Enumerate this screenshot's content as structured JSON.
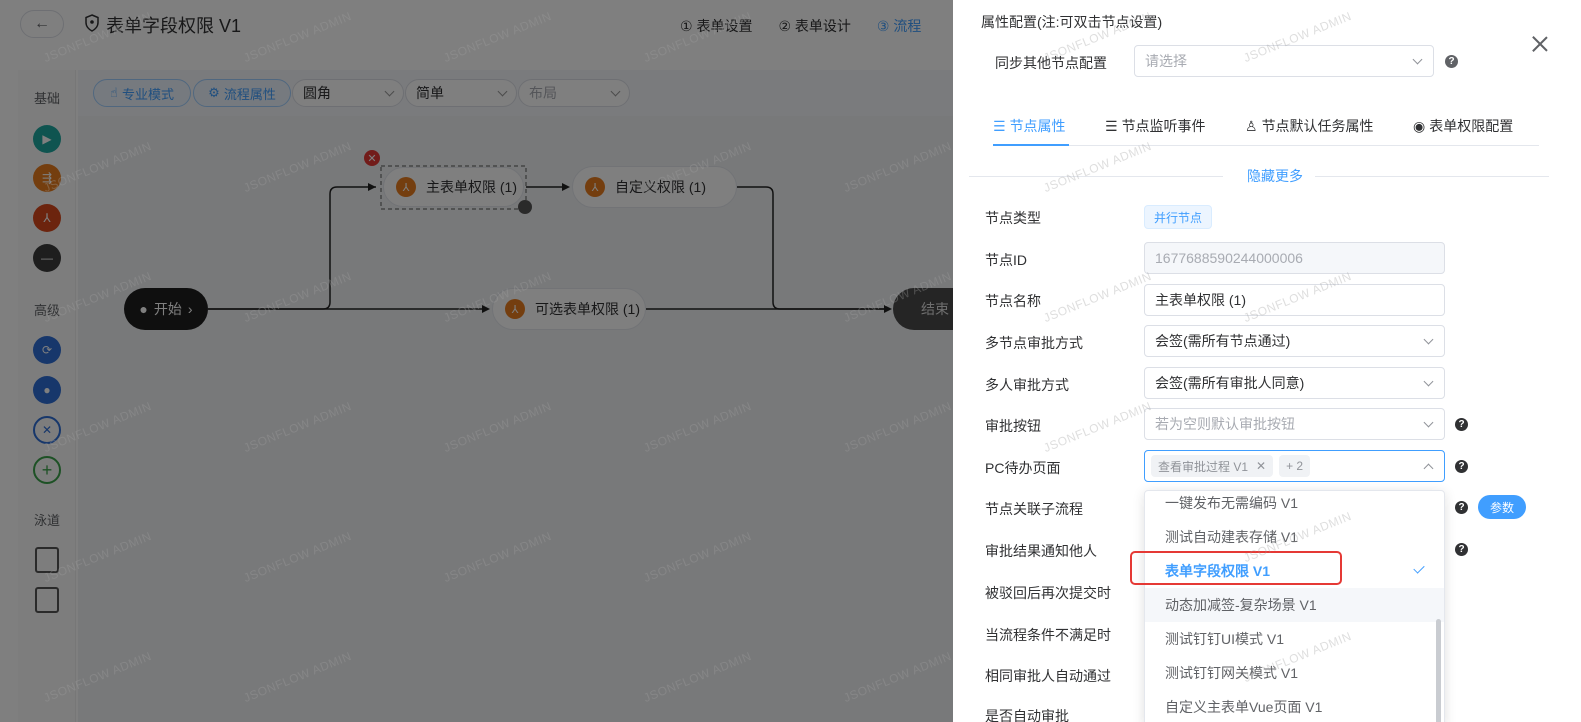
{
  "header": {
    "back_icon": "arrow-left-icon",
    "title": "表单字段权限 V1",
    "steps": [
      {
        "label": "① 表单设置",
        "active": false
      },
      {
        "label": "② 表单设计",
        "active": false
      },
      {
        "label": "③ 流程",
        "active": true
      }
    ]
  },
  "sidebar": {
    "group_basic": "基础",
    "group_advanced": "高级",
    "group_lane": "泳道"
  },
  "toolbar": {
    "pro_mode": "专业模式",
    "flow_props": "流程属性",
    "select_corner": "圆角",
    "select_simple": "简单",
    "select_layout": "布局"
  },
  "canvas": {
    "start_label": "开始",
    "node_main": "主表单权限 (1)",
    "node_custom": "自定义权限 (1)",
    "node_optional": "可选表单权限 (1)",
    "end_label": "结束"
  },
  "watermark": "JSONFLOW ADMIN",
  "drawer": {
    "title": "属性配置(注:可双击节点设置)",
    "sync_label": "同步其他节点配置",
    "sync_placeholder": "请选择",
    "tabs": [
      {
        "label": "节点属性",
        "icon": "sliders-icon",
        "active": true
      },
      {
        "label": "节点监听事件",
        "icon": "sliders-icon",
        "active": false
      },
      {
        "label": "节点默认任务属性",
        "icon": "user-icon",
        "active": false
      },
      {
        "label": "表单权限配置",
        "icon": "eye-icon",
        "active": false
      }
    ],
    "hide_more": "隐藏更多",
    "fields": {
      "node_type_label": "节点类型",
      "node_type_value": "并行节点",
      "node_id_label": "节点ID",
      "node_id_value": "1677688590244000006",
      "node_name_label": "节点名称",
      "node_name_value": "主表单权限 (1)",
      "multi_node_label": "多节点审批方式",
      "multi_node_value": "会签(需所有节点通过)",
      "multi_person_label": "多人审批方式",
      "multi_person_value": "会签(需所有审批人同意)",
      "approve_btn_label": "审批按钮",
      "approve_btn_placeholder": "若为空则默认审批按钮",
      "pc_page_label": "PC待办页面",
      "pc_page_chip": "查看审批过程 V1",
      "pc_page_more": "+ 2",
      "sub_flow_label": "节点关联子流程",
      "param_btn": "参数",
      "notify_label": "审批结果通知他人",
      "reject_label": "被驳回后再次提交时",
      "cond_label": "当流程条件不满足时",
      "same_approver_label": "相同审批人自动通过",
      "auto_approve_label": "是否自动审批"
    },
    "dropdown": {
      "items": [
        {
          "label": "一键发布无需编码 V1",
          "selected": false,
          "hover": false
        },
        {
          "label": "测试自动建表存储 V1",
          "selected": false,
          "hover": false
        },
        {
          "label": "表单字段权限 V1",
          "selected": true,
          "hover": false
        },
        {
          "label": "动态加减签-复杂场景 V1",
          "selected": false,
          "hover": true
        },
        {
          "label": "测试钉钉UI模式 V1",
          "selected": false,
          "hover": false
        },
        {
          "label": "测试钉钉网关模式 V1",
          "selected": false,
          "hover": false
        },
        {
          "label": "自定义主表单Vue页面 V1",
          "selected": false,
          "hover": false
        }
      ]
    }
  },
  "colors": {
    "primary": "#409eff",
    "highlight_red": "#e53935",
    "node_orange": "#e87d1e",
    "start_teal": "#1fa8a0",
    "advanced_blue": "#2f6fd6",
    "lane_green": "#3aa34a"
  }
}
